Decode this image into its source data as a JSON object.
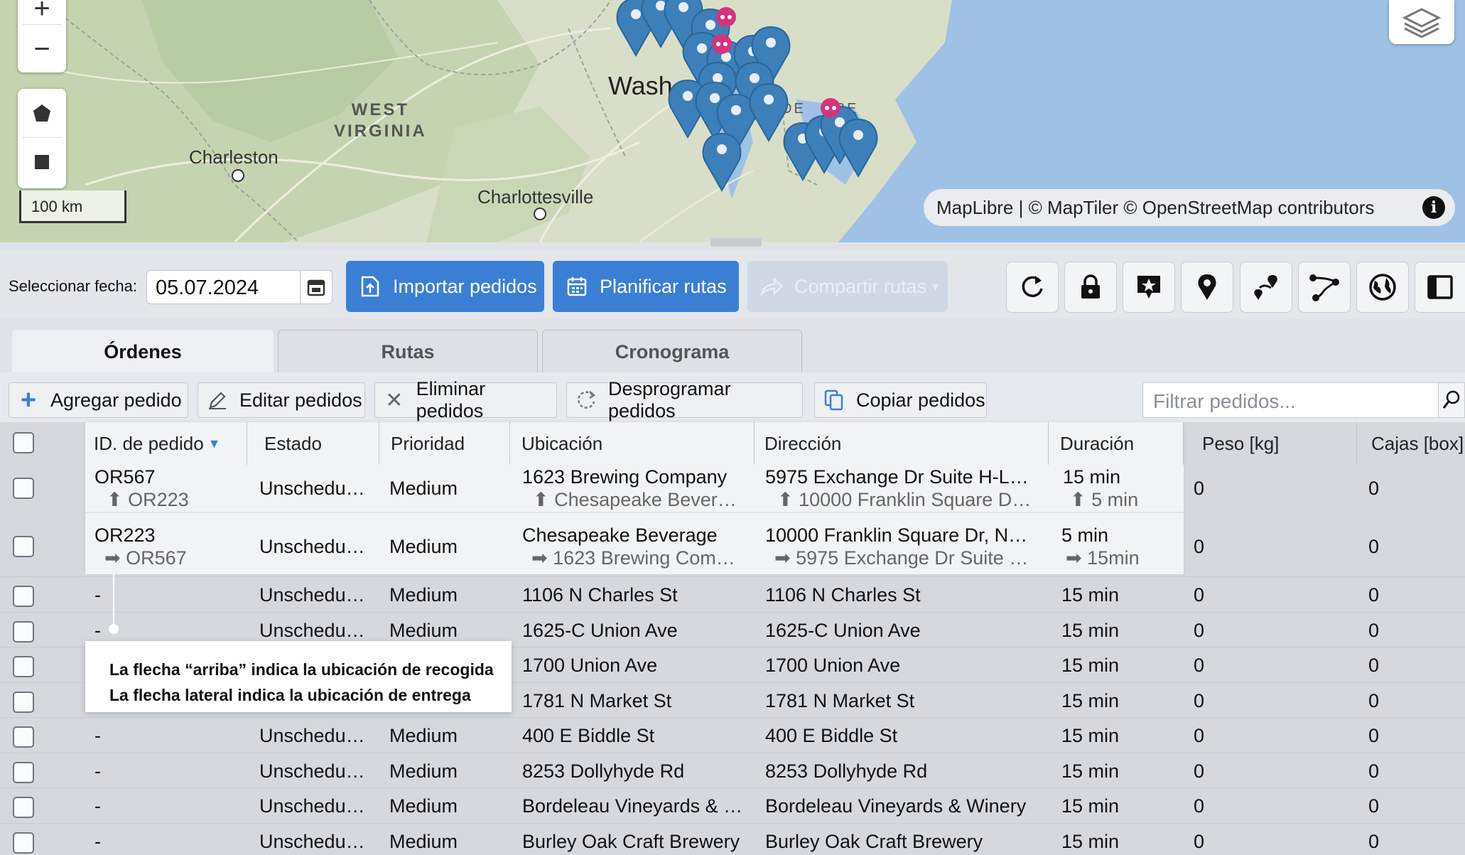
{
  "map": {
    "labels": {
      "west_virginia": "WEST\nVIRGINIA",
      "charleston": "Charleston",
      "charlottesville": "Charlottesville",
      "washington": "Wash",
      "delaware": "DE   ARE"
    },
    "scale": "100 km",
    "attribution": "MapLibre | © MapTiler © OpenStreetMap contributors",
    "info": "i",
    "controls": [
      "plus-icon",
      "minus-icon",
      "polygon-icon",
      "square-icon"
    ],
    "colors": {
      "land": "#d9dec9",
      "water": "#9fc1e6",
      "pin": "#3d7fb8",
      "cluster": "#d4347d"
    }
  },
  "toolbar": {
    "date_label": "Seleccionar fecha:",
    "date_value": "05.07.2024",
    "import_label": "Importar pedidos",
    "plan_label": "Planificar rutas",
    "share_label": "Compartir rutas",
    "icons": [
      "refresh-icon",
      "lock-icon",
      "star-map-pin-icon",
      "location-pin-icon",
      "route-points-icon",
      "route-path-icon",
      "globe-icon",
      "panel-icon"
    ]
  },
  "tabs": [
    {
      "label": "Órdenes",
      "active": true
    },
    {
      "label": "Rutas",
      "active": false
    },
    {
      "label": "Cronograma",
      "active": false
    }
  ],
  "actions": {
    "add": "Agregar pedido",
    "edit": "Editar pedidos",
    "delete": "Eliminar pedidos",
    "unschedule": "Desprogramar pedidos",
    "copy": "Copiar pedidos",
    "filter_placeholder": "Filtrar pedidos..."
  },
  "table": {
    "columns": [
      "ID. de pedido",
      "Estado",
      "Prioridad",
      "Ubicación",
      "Dirección",
      "Duración",
      "Peso [kg]",
      "Cajas [box]"
    ],
    "linked_rows": [
      {
        "id": "OR567",
        "id_sub": "⬆ OR223",
        "status": "Unschedu…",
        "priority": "Medium",
        "location": "1623 Brewing Company",
        "location_sub": "⬆ Chesapeake Bever…",
        "address": "5975 Exchange Dr Suite H-L…",
        "address_sub": "⬆ 10000 Franklin Square D…",
        "duration": "15 min",
        "duration_sub": "⬆ 5 min",
        "weight": "0",
        "boxes": "0"
      },
      {
        "id": "OR223",
        "id_sub": "➡ OR567",
        "status": "Unschedu…",
        "priority": "Medium",
        "location": "Chesapeake Beverage",
        "location_sub": "➡ 1623 Brewing Com…",
        "address": "10000 Franklin Square Dr, N…",
        "address_sub": "➡ 5975 Exchange Dr Suite …",
        "duration": "5 min",
        "duration_sub": "➡ 15min",
        "weight": "0",
        "boxes": "0"
      }
    ],
    "rows": [
      {
        "id": "-",
        "status": "Unschedu…",
        "priority": "Medium",
        "location": "1106 N Charles St",
        "address": "1106 N Charles St",
        "duration": "15 min",
        "weight": "0",
        "boxes": "0"
      },
      {
        "id": "-",
        "status": "Unschedu…",
        "priority": "Medium",
        "location": "1625-C Union Ave",
        "address": "1625-C Union Ave",
        "duration": "15 min",
        "weight": "0",
        "boxes": "0"
      },
      {
        "id": "",
        "status": "",
        "priority": "",
        "location": "1700 Union Ave",
        "address": "1700 Union Ave",
        "duration": "15 min",
        "weight": "0",
        "boxes": "0"
      },
      {
        "id": "",
        "status": "",
        "priority": "",
        "location": "1781 N Market St",
        "address": "1781 N Market St",
        "duration": "15 min",
        "weight": "0",
        "boxes": "0"
      },
      {
        "id": "-",
        "status": "Unschedu…",
        "priority": "Medium",
        "location": "400 E Biddle St",
        "address": "400 E Biddle St",
        "duration": "15 min",
        "weight": "0",
        "boxes": "0"
      },
      {
        "id": "-",
        "status": "Unschedu…",
        "priority": "Medium",
        "location": "8253 Dollyhyde Rd",
        "address": "8253 Dollyhyde Rd",
        "duration": "15 min",
        "weight": "0",
        "boxes": "0"
      },
      {
        "id": "-",
        "status": "Unschedu…",
        "priority": "Medium",
        "location": "Bordeleau Vineyards & …",
        "address": "Bordeleau Vineyards & Winery",
        "duration": "15 min",
        "weight": "0",
        "boxes": "0"
      },
      {
        "id": "-",
        "status": "Unschedu…",
        "priority": "Medium",
        "location": "Burley Oak Craft Brewery",
        "address": "Burley Oak Craft Brewery",
        "duration": "15 min",
        "weight": "0",
        "boxes": "0"
      }
    ]
  },
  "tooltip": {
    "line1": "La flecha “arriba” indica la ubicación de recogida",
    "line2": "La flecha lateral indica la ubicación de entrega"
  }
}
